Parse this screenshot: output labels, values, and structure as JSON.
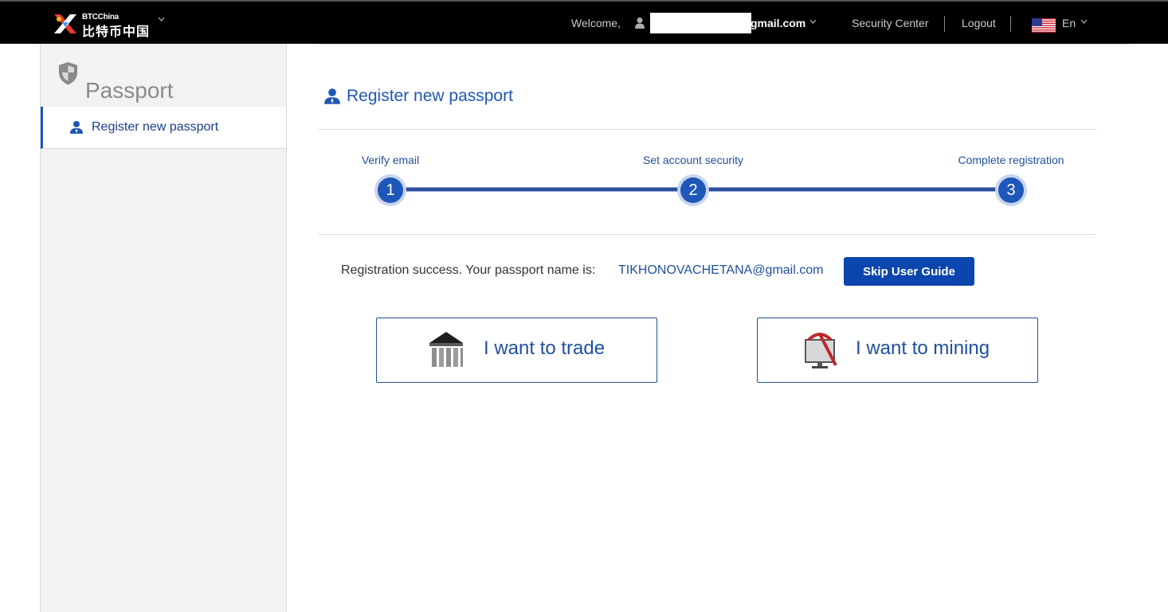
{
  "header": {
    "logo_en": "BTCChina",
    "logo_cn": "比特币中国",
    "welcome": "Welcome,",
    "user_email_suffix": "gmail.com",
    "security_center": "Security Center",
    "logout": "Logout",
    "language": "En"
  },
  "sidebar": {
    "title": "Passport",
    "items": [
      {
        "label": "Register new passport",
        "active": true
      }
    ]
  },
  "main": {
    "title": "Register new passport",
    "steps": [
      {
        "number": "1",
        "label": "Verify email"
      },
      {
        "number": "2",
        "label": "Set account security"
      },
      {
        "number": "3",
        "label": "Complete registration"
      }
    ],
    "success_text": "Registration success. Your passport name is:",
    "passport_name": "TIKHONOVACHETANA@gmail.com",
    "skip_button": "Skip User Guide",
    "choices": [
      {
        "label": "I want to trade",
        "icon": "bank-icon"
      },
      {
        "label": "I want to mining",
        "icon": "mining-icon"
      }
    ]
  },
  "colors": {
    "accent": "#1f57b8",
    "button": "#0b45ae",
    "topbar": "#000000"
  }
}
